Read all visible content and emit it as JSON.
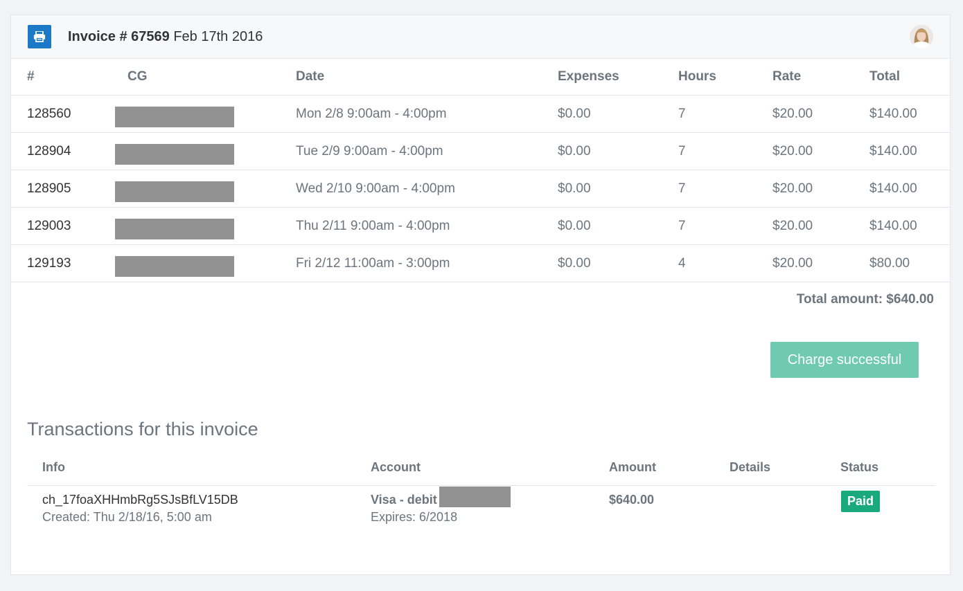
{
  "header": {
    "invoice_label": "Invoice # 67569",
    "invoice_date": "Feb 17th 2016"
  },
  "items_table": {
    "columns": [
      "#",
      "CG",
      "Date",
      "Expenses",
      "Hours",
      "Rate",
      "Total"
    ],
    "rows": [
      {
        "id": "128560",
        "date": "Mon 2/8 9:00am - 4:00pm",
        "expenses": "$0.00",
        "hours": "7",
        "rate": "$20.00",
        "total": "$140.00"
      },
      {
        "id": "128904",
        "date": "Tue 2/9 9:00am - 4:00pm",
        "expenses": "$0.00",
        "hours": "7",
        "rate": "$20.00",
        "total": "$140.00"
      },
      {
        "id": "128905",
        "date": "Wed 2/10 9:00am - 4:00pm",
        "expenses": "$0.00",
        "hours": "7",
        "rate": "$20.00",
        "total": "$140.00"
      },
      {
        "id": "129003",
        "date": "Thu 2/11 9:00am - 4:00pm",
        "expenses": "$0.00",
        "hours": "7",
        "rate": "$20.00",
        "total": "$140.00"
      },
      {
        "id": "129193",
        "date": "Fri 2/12 11:00am - 3:00pm",
        "expenses": "$0.00",
        "hours": "4",
        "rate": "$20.00",
        "total": "$80.00"
      }
    ]
  },
  "total_amount": "Total amount: $640.00",
  "charge_button": "Charge successful",
  "transactions": {
    "title": "Transactions for this invoice",
    "columns": [
      "Info",
      "Account",
      "Amount",
      "Details",
      "Status"
    ],
    "rows": [
      {
        "charge_id": "ch_17foaXHHmbRg5SJsBfLV15DB",
        "created": "Created: Thu 2/18/16, 5:00 am",
        "account": "Visa - debit",
        "expires": "Expires: 6/2018",
        "amount": "$640.00",
        "details": "",
        "status": "Paid"
      }
    ]
  },
  "colors": {
    "accent_blue": "#1b79c8",
    "success_button": "#6fcab0",
    "paid_badge": "#1aa97c",
    "redaction": "#929292"
  }
}
